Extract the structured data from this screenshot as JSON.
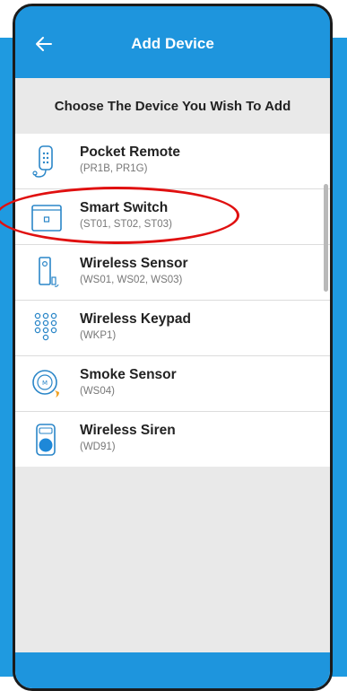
{
  "header": {
    "title": "Add Device",
    "back_icon": "back-arrow-icon"
  },
  "subtitle": "Choose The Device You Wish To Add",
  "devices": [
    {
      "name": "Pocket Remote",
      "models": "(PR1B, PR1G)",
      "icon": "remote-icon"
    },
    {
      "name": "Smart Switch",
      "models": "(ST01, ST02, ST03)",
      "icon": "switch-icon"
    },
    {
      "name": "Wireless Sensor",
      "models": "(WS01, WS02, WS03)",
      "icon": "sensor-icon"
    },
    {
      "name": "Wireless Keypad",
      "models": "(WKP1)",
      "icon": "keypad-icon"
    },
    {
      "name": "Smoke Sensor",
      "models": "(WS04)",
      "icon": "smoke-sensor-icon"
    },
    {
      "name": "Wireless Siren",
      "models": "(WD91)",
      "icon": "siren-icon"
    }
  ],
  "colors": {
    "header": "#1e95dd",
    "highlight": "#e01010",
    "icon": "#2a86c8"
  }
}
